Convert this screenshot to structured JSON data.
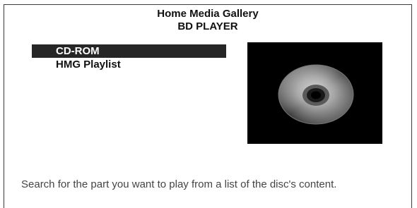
{
  "header": {
    "title": "Home Media Gallery",
    "subtitle": "BD PLAYER"
  },
  "menu": {
    "items": [
      {
        "label": "CD-ROM",
        "selected": true
      },
      {
        "label": "HMG Playlist",
        "selected": false
      }
    ]
  },
  "preview": {
    "icon": "disc-icon"
  },
  "footer": {
    "help_text": "Search for the part you want to play from a list of the disc's content."
  },
  "colors": {
    "selected_bg": "#262626",
    "preview_bg": "#000000",
    "border": "#3a3a3a"
  }
}
